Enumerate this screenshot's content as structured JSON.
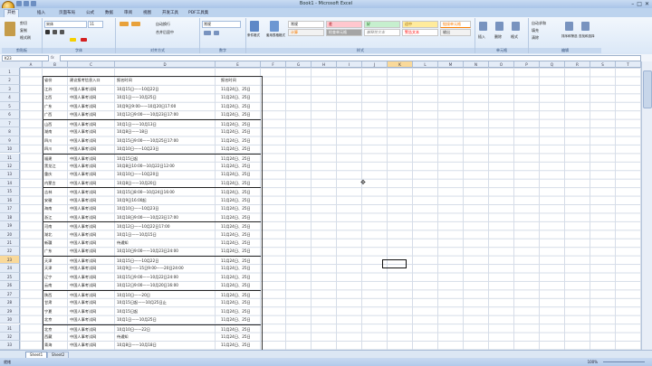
{
  "window": {
    "title": "Book1 - Microsoft Excel"
  },
  "ribbon_tabs": [
    "开始",
    "插入",
    "页面布局",
    "公式",
    "数据",
    "审阅",
    "视图",
    "开发工具",
    "PDF工具集"
  ],
  "ribbon": {
    "clipboard": {
      "label": "剪贴板",
      "cut": "剪切",
      "copy": "复制",
      "format_painter": "格式刷"
    },
    "font": {
      "label": "字体",
      "name": "宋体",
      "size": "11"
    },
    "alignment": {
      "label": "对齐方式",
      "wrap": "自动换行",
      "merge": "合并后居中"
    },
    "number": {
      "label": "数字",
      "format": "常规"
    },
    "styles": {
      "label": "样式",
      "conditional": "条件格式",
      "as_table": "套用表格格式",
      "cells": [
        "常规",
        "差",
        "好",
        "适中",
        "计算",
        "检查单元格",
        "解释性文本",
        "警告文本",
        "链接单元格",
        "输出"
      ]
    },
    "cells": {
      "label": "单元格",
      "insert": "插入",
      "delete": "删除",
      "format": "格式"
    },
    "editing": {
      "label": "编辑",
      "autosum": "自动求和",
      "fill": "填充",
      "clear": "清除",
      "sort": "排序和筛选",
      "find": "查找和选择"
    }
  },
  "namebox": "K23",
  "fx": "fx",
  "columns": [
    "A",
    "B",
    "C",
    "D",
    "E",
    "F",
    "G",
    "H",
    "I",
    "J",
    "K",
    "L",
    "M",
    "N",
    "O",
    "P",
    "Q",
    "R",
    "S",
    "T",
    "U",
    "V",
    "W"
  ],
  "selected_column": "K",
  "rows": [
    "1",
    "2",
    "3",
    "4",
    "5",
    "6",
    "7",
    "8",
    "9",
    "10",
    "11",
    "12",
    "13",
    "14",
    "15",
    "16",
    "17",
    "18",
    "19",
    "20",
    "21",
    "22",
    "23",
    "24",
    "25",
    "26",
    "27",
    "28",
    "29",
    "30",
    "31",
    "32",
    "33"
  ],
  "selected_row": "23",
  "table_header": [
    "省份",
    "建议报考信息入口",
    "报名时间",
    "报名时间"
  ],
  "table_rows": [
    [
      "江苏",
      "中国人事考试网",
      "10月15日——10月22日",
      "11月24日、25日"
    ],
    [
      "江西",
      "中国人事考试网",
      "10月1日——10月25日",
      "11月24日、25日"
    ],
    [
      "广东",
      "中国人事考试网",
      "10月9日9:00——10月20日17:00",
      "11月24日、25日"
    ],
    [
      "广西",
      "中国人事考试网",
      "10月12日9:00——10月23日17:00",
      "11月24日、25日"
    ],
    [
      "山西",
      "中国人事考试网",
      "10月1日——10月13日",
      "11月24日、25日"
    ],
    [
      "湖南",
      "中国人事考试网",
      "10月8日——18日",
      "11月24日、25日"
    ],
    [
      "四川",
      "中国人事考试网",
      "10月15日9:00——10月25日17:00",
      "11月24日、25日"
    ],
    [
      "四川",
      "中国人事考试网",
      "10月10日——10月23日",
      "11月24日、25日"
    ],
    [
      "福建",
      "中国人事考试网",
      "10月15日起",
      "11月24日、25日"
    ],
    [
      "黑龙江",
      "中国人事考试网",
      "10月8日10:00—10月22日12:00",
      "11月24日、25日"
    ],
    [
      "重庆",
      "中国人事考试网",
      "10月10日——10月20日",
      "11月24日、25日"
    ],
    [
      "内蒙古",
      "中国人事考试网",
      "10月8日——10月20日",
      "11月24日、25日"
    ],
    [
      "吉林",
      "中国人事考试网",
      "10月15日8:00—10月24日16:00",
      "11月24日、25日"
    ],
    [
      "安徽",
      "中国人事考试网",
      "10月9日16:00起",
      "11月24日、25日"
    ],
    [
      "海南",
      "中国人事考试网",
      "10月10日——10月23日",
      "11月24日、25日"
    ],
    [
      "浙江",
      "中国人事考试网",
      "10月18日9:00——10月23日17:00",
      "11月24日、25日"
    ],
    [
      "河南",
      "中国人事考试网",
      "10月12日——10月22日17:00",
      "11月24日、25日"
    ],
    [
      "湖北",
      "中国人事考试网",
      "10月1日——10月15日",
      "11月24日、25日"
    ],
    [
      "新疆",
      "中国人事考试网",
      "待通知",
      "11月24日、25日"
    ],
    [
      "广东",
      "中国人事考试网",
      "10月10日9:00——10月23日24:00",
      "11月24日、25日"
    ],
    [
      "天津",
      "中国人事考试网",
      "10月15日——10月22日",
      "11月24日、25日"
    ],
    [
      "天津",
      "中国人事考试网",
      "10月9日——15日9:00——20日24:00",
      "11月24日、25日"
    ],
    [
      "辽宁",
      "中国人事考试网",
      "10月15日9:00——10月22日24:00",
      "11月24日、25日"
    ],
    [
      "云南",
      "中国人事考试网",
      "10月12日9:00——10月20日16:00",
      "11月24日、25日"
    ],
    [
      "陕西",
      "中国人事考试网",
      "10月10日——20日",
      "11月24日、25日"
    ],
    [
      "甘肃",
      "中国人事考试网",
      "10月15日起——10月25日止",
      "11月24日、25日"
    ],
    [
      "宁夏",
      "中国人事考试网",
      "10月15日起",
      "11月24日、25日"
    ],
    [
      "北京",
      "中国人事考试网",
      "10月1日——10月25日",
      "11月24日、25日"
    ],
    [
      "北京",
      "中国人事考试网",
      "10月10日——22日",
      "11月24日、25日"
    ],
    [
      "西藏",
      "中国人事考试网",
      "待通知",
      "11月24日、25日"
    ],
    [
      "青海",
      "中国人事考试网",
      "10月8日——10月18日",
      "11月24日、25日"
    ]
  ],
  "sheet_tabs": [
    "Sheet1",
    "Sheet2"
  ],
  "status": {
    "ready": "就绪",
    "zoom": "100%"
  }
}
